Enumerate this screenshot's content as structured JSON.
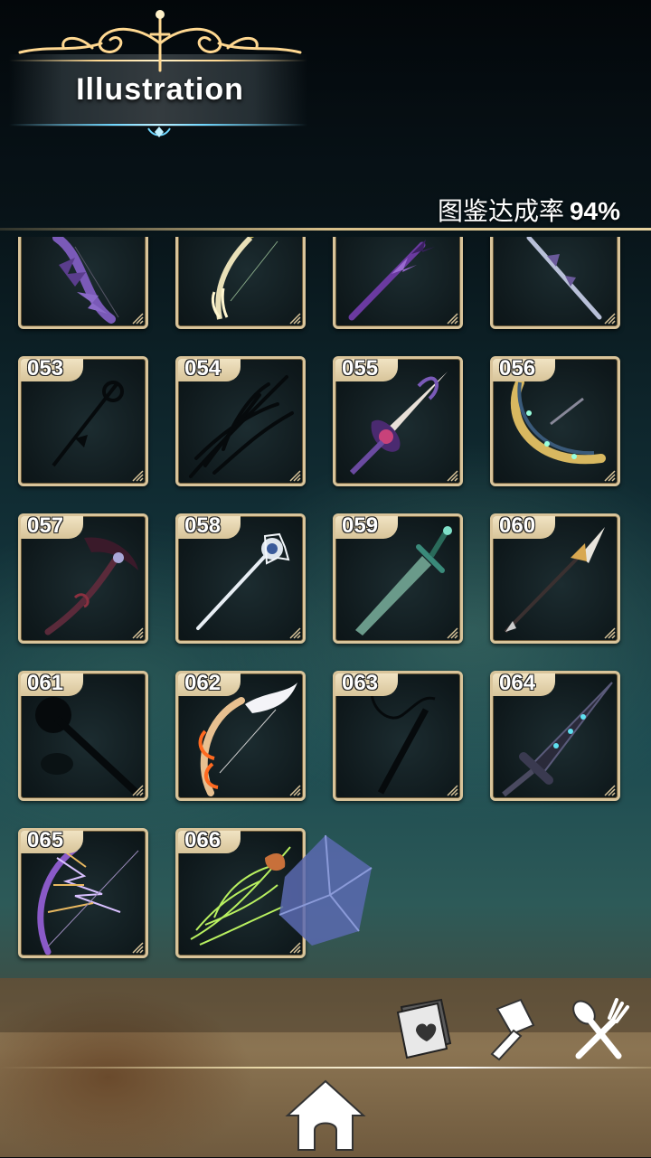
{
  "header": {
    "title": "Illustration"
  },
  "completion": {
    "label": "图鉴达成率",
    "value": "94%"
  },
  "colors": {
    "card_border": "#d9c49a",
    "ornament_gold": "#ffd891",
    "accent_blue": "#6fd7ff"
  },
  "weapons": [
    {
      "number": "",
      "kind": "bat-wing-bow"
    },
    {
      "number": "",
      "kind": "feather-bow"
    },
    {
      "number": "",
      "kind": "purple-lance"
    },
    {
      "number": "",
      "kind": "silver-lance"
    },
    {
      "number": "053",
      "kind": "silhouette-staff"
    },
    {
      "number": "054",
      "kind": "silhouette-branches"
    },
    {
      "number": "055",
      "kind": "jeweled-sword"
    },
    {
      "number": "056",
      "kind": "golden-crescent-bow"
    },
    {
      "number": "057",
      "kind": "dark-scythe"
    },
    {
      "number": "058",
      "kind": "silver-spear"
    },
    {
      "number": "059",
      "kind": "jade-sword"
    },
    {
      "number": "060",
      "kind": "golden-spear"
    },
    {
      "number": "061",
      "kind": "silhouette-mace"
    },
    {
      "number": "062",
      "kind": "winged-flame-bow"
    },
    {
      "number": "063",
      "kind": "silhouette-whip"
    },
    {
      "number": "064",
      "kind": "dark-greatsword"
    },
    {
      "number": "065",
      "kind": "violet-lightning-bow"
    },
    {
      "number": "066",
      "kind": "green-thorn-spear"
    }
  ],
  "toolbar": {
    "items": [
      {
        "icon": "book-icon"
      },
      {
        "icon": "hammer-icon"
      },
      {
        "icon": "fork-spoon-icon"
      }
    ],
    "home": {
      "icon": "home-icon"
    }
  }
}
